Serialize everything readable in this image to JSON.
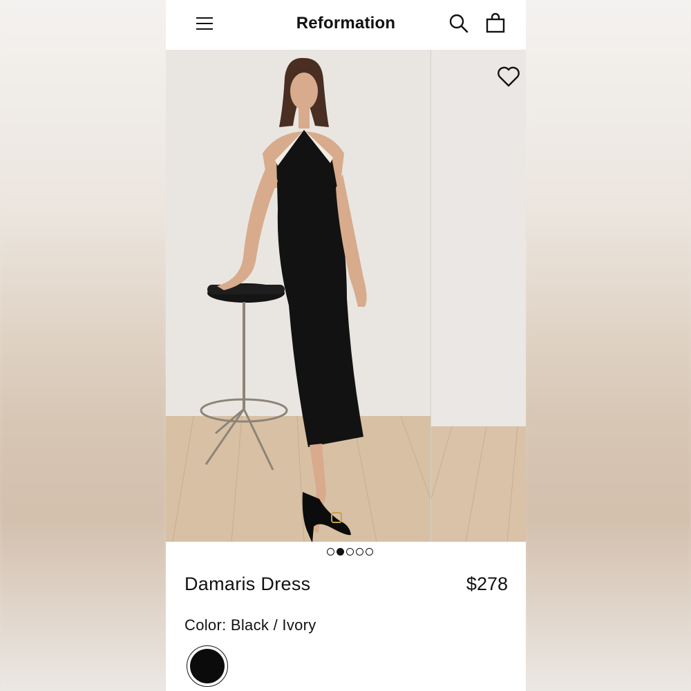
{
  "header": {
    "brand": "Reformation",
    "icons": [
      "menu-icon",
      "search-icon",
      "shopping-bag-icon"
    ]
  },
  "gallery": {
    "image_count": 5,
    "active_index": 1,
    "favorite_icon": "heart-icon"
  },
  "product": {
    "name": "Damaris Dress",
    "price": "$278",
    "color_text": "Color: Black / Ivory"
  },
  "colors": {
    "swatch_selected": "#0b0b0b"
  }
}
